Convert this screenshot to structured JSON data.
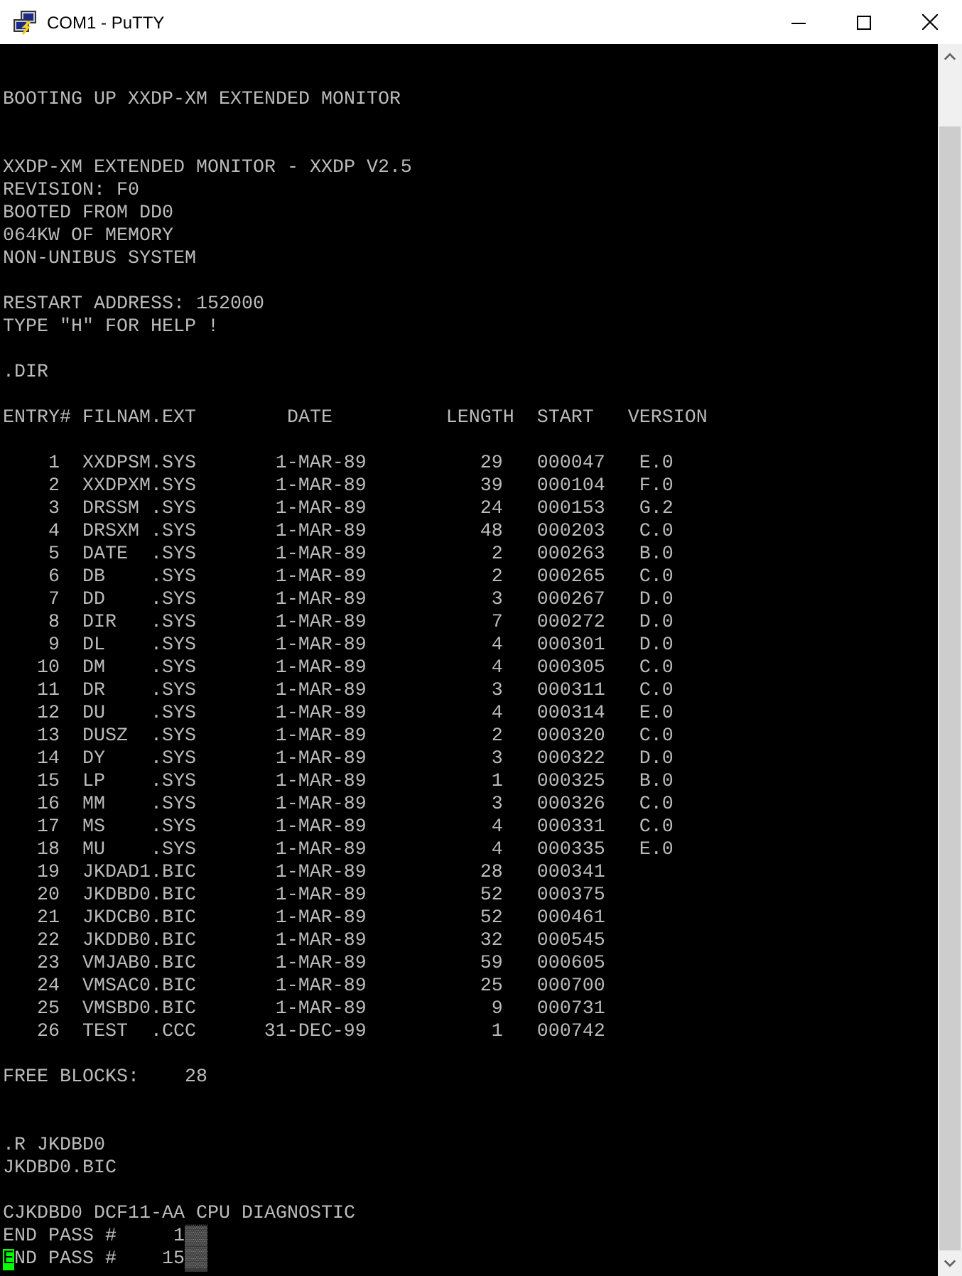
{
  "window": {
    "title": "COM1 - PuTTY"
  },
  "terminal": {
    "lines": [
      {
        "kind": "blank"
      },
      {
        "kind": "blank"
      },
      {
        "kind": "text",
        "text": "BOOTING UP XXDP-XM EXTENDED MONITOR"
      },
      {
        "kind": "blank"
      },
      {
        "kind": "blank"
      },
      {
        "kind": "text",
        "text": "XXDP-XM EXTENDED MONITOR - XXDP V2.5"
      },
      {
        "kind": "text",
        "text": "REVISION: F0"
      },
      {
        "kind": "text",
        "text": "BOOTED FROM DD0"
      },
      {
        "kind": "text",
        "text": "064KW OF MEMORY"
      },
      {
        "kind": "text",
        "text": "NON-UNIBUS SYSTEM"
      },
      {
        "kind": "blank"
      },
      {
        "kind": "text",
        "text": "RESTART ADDRESS: 152000"
      },
      {
        "kind": "text",
        "text": "TYPE \"H\" FOR HELP !"
      },
      {
        "kind": "blank"
      },
      {
        "kind": "text",
        "text": ".DIR"
      },
      {
        "kind": "blank"
      },
      {
        "kind": "header",
        "cells": [
          "ENTRY#",
          "FILNAM.EXT",
          "DATE",
          "LENGTH",
          "START",
          "VERSION"
        ]
      },
      {
        "kind": "blank"
      },
      {
        "kind": "row",
        "cells": [
          "1",
          "XXDPSM.SYS",
          "1-MAR-89",
          "29",
          "000047",
          "E.0"
        ]
      },
      {
        "kind": "row",
        "cells": [
          "2",
          "XXDPXM.SYS",
          "1-MAR-89",
          "39",
          "000104",
          "F.0"
        ]
      },
      {
        "kind": "row",
        "cells": [
          "3",
          "DRSSM .SYS",
          "1-MAR-89",
          "24",
          "000153",
          "G.2"
        ]
      },
      {
        "kind": "row",
        "cells": [
          "4",
          "DRSXM .SYS",
          "1-MAR-89",
          "48",
          "000203",
          "C.0"
        ]
      },
      {
        "kind": "row",
        "cells": [
          "5",
          "DATE  .SYS",
          "1-MAR-89",
          "2",
          "000263",
          "B.0"
        ]
      },
      {
        "kind": "row",
        "cells": [
          "6",
          "DB    .SYS",
          "1-MAR-89",
          "2",
          "000265",
          "C.0"
        ]
      },
      {
        "kind": "row",
        "cells": [
          "7",
          "DD    .SYS",
          "1-MAR-89",
          "3",
          "000267",
          "D.0"
        ]
      },
      {
        "kind": "row",
        "cells": [
          "8",
          "DIR   .SYS",
          "1-MAR-89",
          "7",
          "000272",
          "D.0"
        ]
      },
      {
        "kind": "row",
        "cells": [
          "9",
          "DL    .SYS",
          "1-MAR-89",
          "4",
          "000301",
          "D.0"
        ]
      },
      {
        "kind": "row",
        "cells": [
          "10",
          "DM    .SYS",
          "1-MAR-89",
          "4",
          "000305",
          "C.0"
        ]
      },
      {
        "kind": "row",
        "cells": [
          "11",
          "DR    .SYS",
          "1-MAR-89",
          "3",
          "000311",
          "C.0"
        ]
      },
      {
        "kind": "row",
        "cells": [
          "12",
          "DU    .SYS",
          "1-MAR-89",
          "4",
          "000314",
          "E.0"
        ]
      },
      {
        "kind": "row",
        "cells": [
          "13",
          "DUSZ  .SYS",
          "1-MAR-89",
          "2",
          "000320",
          "C.0"
        ]
      },
      {
        "kind": "row",
        "cells": [
          "14",
          "DY    .SYS",
          "1-MAR-89",
          "3",
          "000322",
          "D.0"
        ]
      },
      {
        "kind": "row",
        "cells": [
          "15",
          "LP    .SYS",
          "1-MAR-89",
          "1",
          "000325",
          "B.0"
        ]
      },
      {
        "kind": "row",
        "cells": [
          "16",
          "MM    .SYS",
          "1-MAR-89",
          "3",
          "000326",
          "C.0"
        ]
      },
      {
        "kind": "row",
        "cells": [
          "17",
          "MS    .SYS",
          "1-MAR-89",
          "4",
          "000331",
          "C.0"
        ]
      },
      {
        "kind": "row",
        "cells": [
          "18",
          "MU    .SYS",
          "1-MAR-89",
          "4",
          "000335",
          "E.0"
        ]
      },
      {
        "kind": "row",
        "cells": [
          "19",
          "JKDAD1.BIC",
          "1-MAR-89",
          "28",
          "000341"
        ]
      },
      {
        "kind": "row",
        "cells": [
          "20",
          "JKDBD0.BIC",
          "1-MAR-89",
          "52",
          "000375"
        ]
      },
      {
        "kind": "row",
        "cells": [
          "21",
          "JKDCB0.BIC",
          "1-MAR-89",
          "52",
          "000461"
        ]
      },
      {
        "kind": "row",
        "cells": [
          "22",
          "JKDDB0.BIC",
          "1-MAR-89",
          "32",
          "000545"
        ]
      },
      {
        "kind": "row",
        "cells": [
          "23",
          "VMJAB0.BIC",
          "1-MAR-89",
          "59",
          "000605"
        ]
      },
      {
        "kind": "row",
        "cells": [
          "24",
          "VMSAC0.BIC",
          "1-MAR-89",
          "25",
          "000700"
        ]
      },
      {
        "kind": "row",
        "cells": [
          "25",
          "VMSBD0.BIC",
          "1-MAR-89",
          "9",
          "000731"
        ]
      },
      {
        "kind": "row",
        "cells": [
          "26",
          "TEST  .CCC",
          "31-DEC-99",
          "1",
          "000742"
        ]
      },
      {
        "kind": "blank"
      },
      {
        "kind": "text",
        "text": "FREE BLOCKS:    28"
      },
      {
        "kind": "blank"
      },
      {
        "kind": "blank"
      },
      {
        "kind": "text",
        "text": ".R JKDBD0"
      },
      {
        "kind": "text",
        "text": "JKDBD0.BIC"
      },
      {
        "kind": "blank"
      },
      {
        "kind": "text",
        "text": "CJKDBD0 DCF11-AA CPU DIAGNOSTIC"
      },
      {
        "kind": "pass",
        "text": "END PASS #     1",
        "noise": "▒▒",
        "cursor": false
      },
      {
        "kind": "pass",
        "text": "END PASS #    15",
        "noise": "▒▒",
        "cursor": true
      }
    ]
  }
}
